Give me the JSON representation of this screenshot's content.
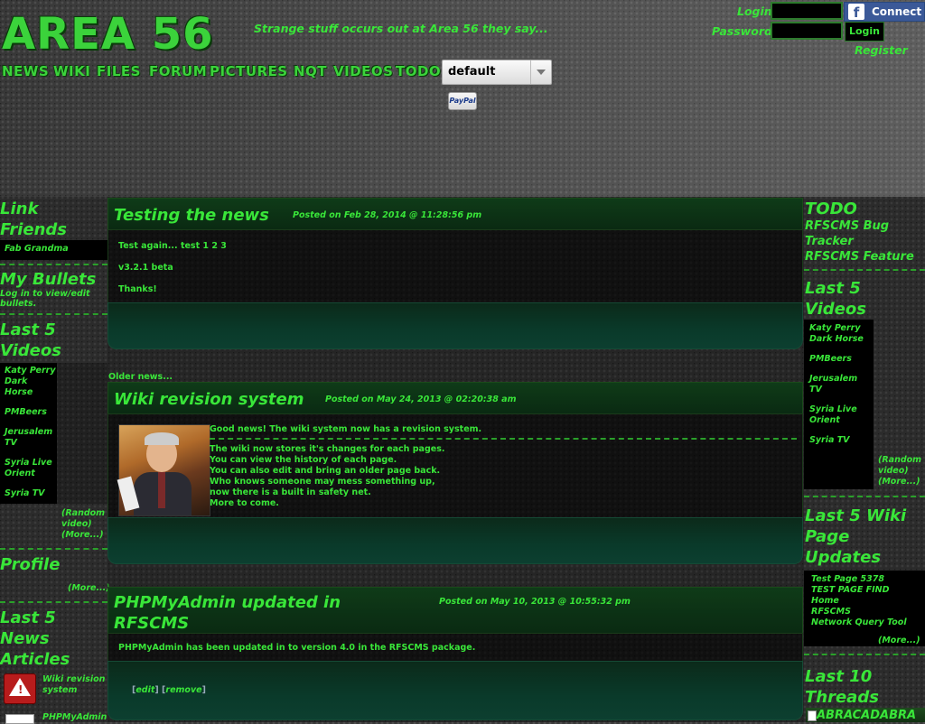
{
  "header": {
    "logo": "AREA 56",
    "tagline": "Strange stuff occurs out at Area 56 they say...",
    "login_label": "Login",
    "password_label": "Password",
    "login_value": "",
    "password_value": "",
    "fb_connect": "Connect",
    "login_button": "Login",
    "register": "Register"
  },
  "nav": {
    "items": [
      "NEWS",
      "WIKI",
      "FILES",
      "FORUM",
      "PICTURES",
      "NQT",
      "VIDEOS",
      "TODO"
    ],
    "theme_selected": "default",
    "paypal": "PayPal"
  },
  "left": {
    "link_friends_title": "Link Friends",
    "link_friends": [
      "Fab Grandma"
    ],
    "bullets_title": "My Bullets",
    "bullets_text": "Log in to view/edit bullets.",
    "videos_title": "Last 5 Videos",
    "videos": [
      "Katy Perry Dark Horse",
      "PMBeers",
      "Jerusalem TV",
      "Syria Live Orient",
      "Syria TV"
    ],
    "random_video": "Random video",
    "more": "More...",
    "profile_title": "Profile",
    "profile_more": "More...",
    "news_title": "Last 5 News Articles",
    "news_articles": [
      "Wiki revision system",
      "PHPMyAdmin"
    ]
  },
  "center": {
    "posts": [
      {
        "title": "Testing the news",
        "date": "Posted on Feb 28, 2014 @ 11:28:56 pm",
        "lines": [
          "Test again... test 1 2 3",
          "v3.2.1 beta",
          "Thanks!"
        ]
      },
      {
        "title": "Wiki revision system",
        "date": "Posted on May 24, 2013 @ 02:20:38 am",
        "lead": "Good news! The wiki system now has a revision system.",
        "lines": [
          "The wiki now stores it's changes for each pages.",
          "You can view the history of each page.",
          "You can also edit and bring an older page back.",
          "Who knows someone may mess something up,",
          "now there is a built in safety net.",
          "More to come."
        ]
      },
      {
        "title": "PHPMyAdmin updated in RFSCMS",
        "date": "Posted on May 10, 2013 @ 10:55:32 pm",
        "lines": [
          "PHPMyAdmin has been updated in to version 4.0 in the RFSCMS package."
        ],
        "edit": "edit",
        "remove": "remove"
      }
    ],
    "older_news": "Older news..."
  },
  "right": {
    "todo_title": "TODO",
    "todo_items": [
      "RFSCMS Bug Tracker",
      "RFSCMS Feature"
    ],
    "videos_title": "Last 5 Videos",
    "videos": [
      "Katy Perry Dark Horse",
      "PMBeers",
      "Jerusalem TV",
      "Syria Live Orient",
      "Syria TV"
    ],
    "random_video": "Random video",
    "more": "More...",
    "wiki_title": "Last 5 Wiki Page Updates",
    "wiki_items": [
      "Test Page 5378",
      "TEST PAGE FIND",
      "Home",
      "RFSCMS",
      "Network Query Tool"
    ],
    "wiki_more": "More...",
    "threads_title": "Last 10 Threads",
    "threads": [
      "ABRACADABRA"
    ]
  }
}
